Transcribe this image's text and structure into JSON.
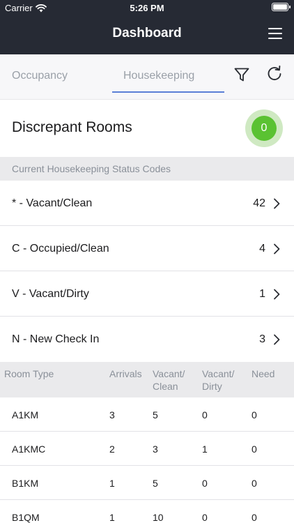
{
  "status_bar": {
    "carrier": "Carrier",
    "time": "5:26 PM"
  },
  "header": {
    "title": "Dashboard"
  },
  "tabs": [
    {
      "label": "Occupancy",
      "active": false
    },
    {
      "label": "Housekeeping",
      "active": true
    }
  ],
  "discrepant": {
    "title": "Discrepant Rooms",
    "count": "0"
  },
  "status_codes": {
    "section_label": "Current Housekeeping Status Codes",
    "items": [
      {
        "label": "* - Vacant/Clean",
        "count": "42"
      },
      {
        "label": "C - Occupied/Clean",
        "count": "4"
      },
      {
        "label": "V - Vacant/Dirty",
        "count": "1"
      },
      {
        "label": "N - New Check In",
        "count": "3"
      }
    ]
  },
  "room_table": {
    "headers": {
      "room_type": "Room Type",
      "arrivals": "Arrivals",
      "vacant_clean": "Vacant/ Clean",
      "vacant_dirty": "Vacant/ Dirty",
      "need": "Need"
    },
    "rows": [
      {
        "room_type": "A1KM",
        "arrivals": "3",
        "vacant_clean": "5",
        "vacant_dirty": "0",
        "need": "0"
      },
      {
        "room_type": "A1KMC",
        "arrivals": "2",
        "vacant_clean": "3",
        "vacant_dirty": "1",
        "need": "0"
      },
      {
        "room_type": "B1KM",
        "arrivals": "1",
        "vacant_clean": "5",
        "vacant_dirty": "0",
        "need": "0"
      },
      {
        "room_type": "B1QM",
        "arrivals": "1",
        "vacant_clean": "10",
        "vacant_dirty": "0",
        "need": "0"
      }
    ]
  },
  "icons": {
    "wifi": "wifi-icon",
    "battery": "battery-icon",
    "menu": "hamburger-menu-icon",
    "filter": "filter-icon",
    "refresh": "refresh-icon",
    "chevron": "chevron-right-icon"
  },
  "colors": {
    "header_bg": "#262a34",
    "tab_underline": "#5a7fd6",
    "badge_green": "#5ac232",
    "badge_halo": "#cfe9c2",
    "section_bg": "#eaeaec"
  }
}
